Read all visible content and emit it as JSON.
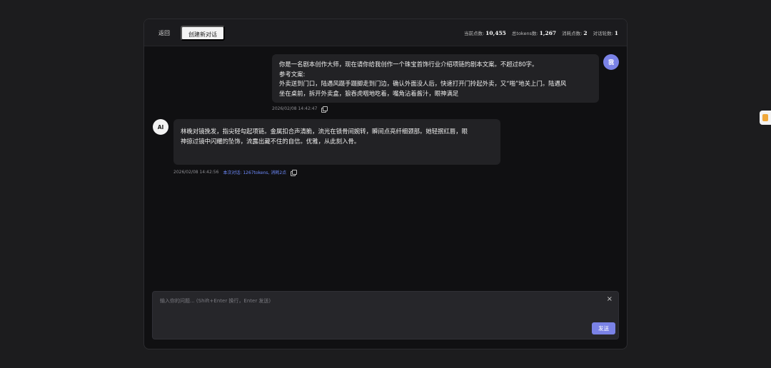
{
  "toolbar": {
    "back_label": "返回",
    "new_chat_label": "创建新对话"
  },
  "stats": [
    {
      "label": "当前点数:",
      "value": "10,455"
    },
    {
      "label": "总tokens数:",
      "value": "1,267"
    },
    {
      "label": "消耗点数:",
      "value": "2"
    },
    {
      "label": "对话轮数:",
      "value": "1"
    }
  ],
  "messages": {
    "user": {
      "avatar": "我",
      "lines": [
        "你是一名剧本创作大师，现在请你给我创作一个珠宝首饰行业介绍项链的剧本文案。不超过80字。",
        "参考文案:",
        "外卖送到门口，陆遇风蹑手蹑脚走到门边，确认外面没人后，快速打开门拎起外卖，又“啪”地关上门。陆遇风",
        "坐在桌前，拆开外卖盒，狼吞虎咽地吃着，嘴角沾着酱汁，眼神满足"
      ],
      "timestamp": "2026/02/08 14:42:47"
    },
    "ai": {
      "avatar": "AI",
      "lines": [
        "林晚对镜挽发，指尖轻勾起项链。金属扣合声清脆，流光在锁骨间婉转，瞬间点亮纤细颈部。她轻抿红唇，眼",
        "神掠过镜中闪耀的坠饰，流露出藏不住的自信。优雅，从此刻入骨。"
      ],
      "timestamp": "2026/02/08 14:42:56",
      "usage": "本次对话: 1267tokens, 消耗2点"
    }
  },
  "composer": {
    "placeholder": "输入你的问题... (Shift+Enter 换行，Enter 发送)",
    "value": "",
    "send_label": "发送",
    "close_glyph": "×"
  },
  "icons": {
    "copy": "copy-icon",
    "close": "close-icon"
  },
  "colors": {
    "accent": "#7a82e6",
    "link": "#6f8cff",
    "background": "#1c1c1e"
  }
}
